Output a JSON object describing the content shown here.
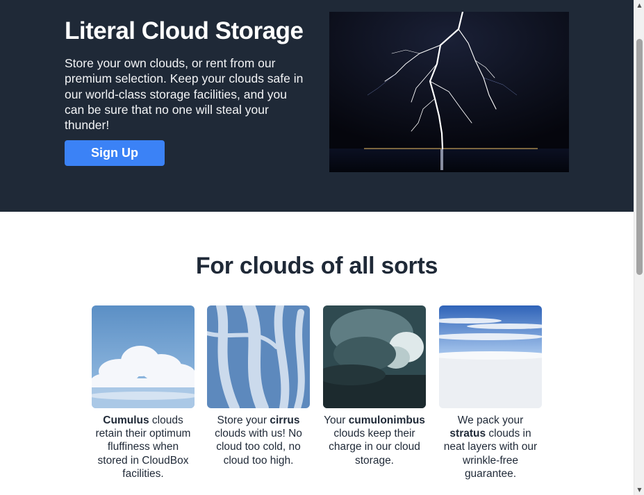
{
  "hero": {
    "title": "Literal Cloud Storage",
    "description": "Store your own clouds, or rent from our premium selection. Keep your clouds safe in our world-class storage facilities, and you can be sure that no one will steal your thunder!",
    "signup_label": "Sign Up",
    "image": "lightning-over-water"
  },
  "section": {
    "title": "For clouds of all sorts"
  },
  "cards": [
    {
      "image": "cumulus-clouds",
      "pre": "",
      "bold": "Cumulus",
      "post": " clouds retain their optimum fluffiness when stored in CloudBox facilities."
    },
    {
      "image": "cirrus-clouds",
      "pre": "Store your ",
      "bold": "cirrus",
      "post": " clouds with us! No cloud too cold, no cloud too high."
    },
    {
      "image": "cumulonimbus-clouds",
      "pre": "Your ",
      "bold": "cumulonimbus",
      "post": " clouds keep their charge in our cloud storage."
    },
    {
      "image": "stratus-clouds",
      "pre": "We pack your ",
      "bold": "stratus",
      "post": " clouds in neat layers with our wrinkle-free guarantee."
    }
  ],
  "colors": {
    "hero_bg": "#1f2937",
    "button": "#3b82f6",
    "text_dark": "#1f2937"
  },
  "scrollbar": {
    "up_icon": "scroll-up-arrow",
    "down_icon": "scroll-down-arrow"
  }
}
